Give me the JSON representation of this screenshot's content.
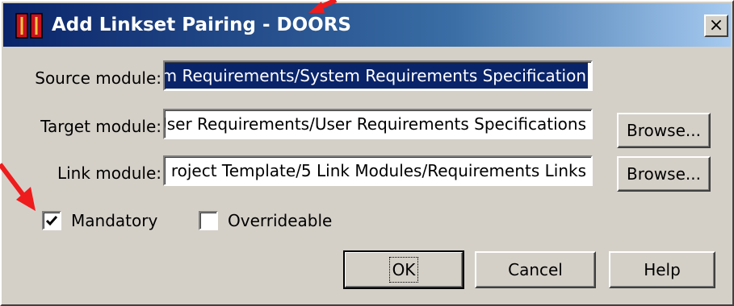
{
  "window": {
    "title": "Add Linkset Pairing - DOORS",
    "close_label": "×"
  },
  "form": {
    "source_label": "Source module:",
    "source_value": "em Requirements/System Requirements Specification",
    "target_label": "Target module:",
    "target_value": "User Requirements/User Requirements Specifications",
    "link_label": "Link module:",
    "link_value": "roject Template/5 Link Modules/Requirements Links"
  },
  "buttons": {
    "browse_target": "Browse...",
    "browse_link": "Browse...",
    "ok": "OK",
    "cancel": "Cancel",
    "help": "Help"
  },
  "options": {
    "mandatory_label": "Mandatory",
    "mandatory_checked": true,
    "overrideable_label": "Overrideable",
    "overrideable_checked": false
  },
  "colors": {
    "title_gradient_start": "#0a246a",
    "title_gradient_end": "#a6caf0",
    "dialog_face": "#d4d0c8",
    "selection": "#0a246a",
    "annotation_arrow": "#ee1c1c"
  },
  "icons": {
    "app": "doors-app-icon",
    "close": "close-icon",
    "check": "checkmark-icon",
    "annotation": "red-arrow-icon"
  }
}
